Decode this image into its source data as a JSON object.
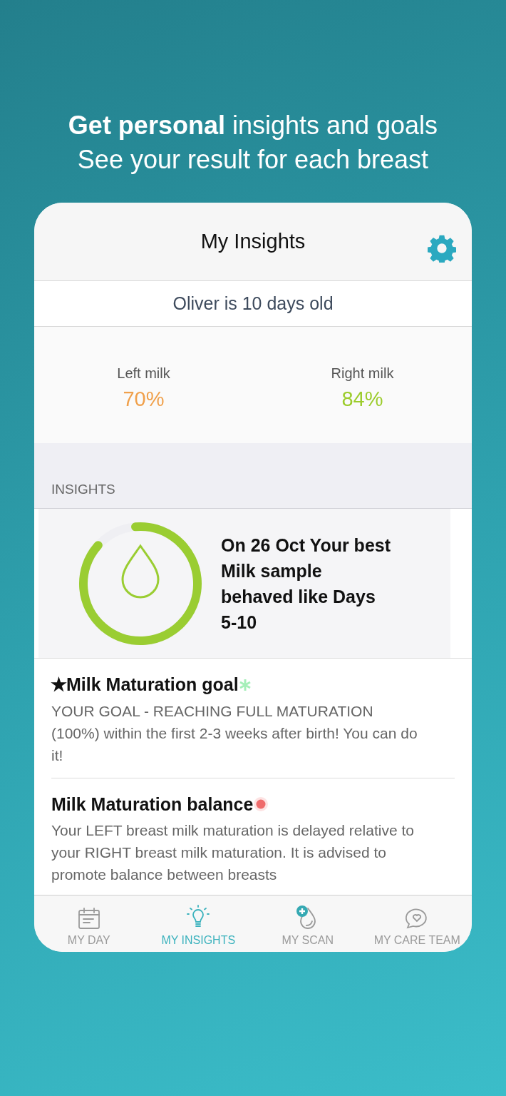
{
  "headline": [
    "**Get personal** insights and goals",
    "See your result for each breast"
  ],
  "header": {
    "title": "My Insights"
  },
  "subtitle": "Oliver is 10 days old",
  "milk": [
    {
      "label": "Left milk",
      "value": "70%",
      "color": "#f0a04b"
    },
    {
      "label": "Right milk",
      "value": "84%",
      "color": "#9ccc2c"
    }
  ],
  "section_label": "INSIGHTS",
  "highlight": {
    "text": "On 26 Oct Your best Milk sample behaved like Days 5-10"
  },
  "insights": [
    {
      "title": "✭Milk Maturation goal",
      "kind": "asterisk",
      "color": "#a6efb9",
      "body": "YOUR GOAL - REACHING FULL MATURATION (100%) within the first 2-3 weeks after birth! You can do it!"
    },
    {
      "title": "Milk Maturation balance",
      "kind": "dot",
      "color": "#ef6b6b",
      "body": "Your LEFT breast milk maturation is delayed relative to your RIGHT breast milk maturation. It is advised to promote balance between breasts"
    }
  ],
  "tabs": [
    {
      "label": "MY DAY",
      "kind": "calendar",
      "selected": false
    },
    {
      "label": "MY INSIGHTS",
      "kind": "bulb",
      "selected": true
    },
    {
      "label": "MY SCAN",
      "kind": "scan",
      "selected": false
    },
    {
      "label": "MY CARE TEAM",
      "kind": "chat",
      "selected": false
    }
  ]
}
